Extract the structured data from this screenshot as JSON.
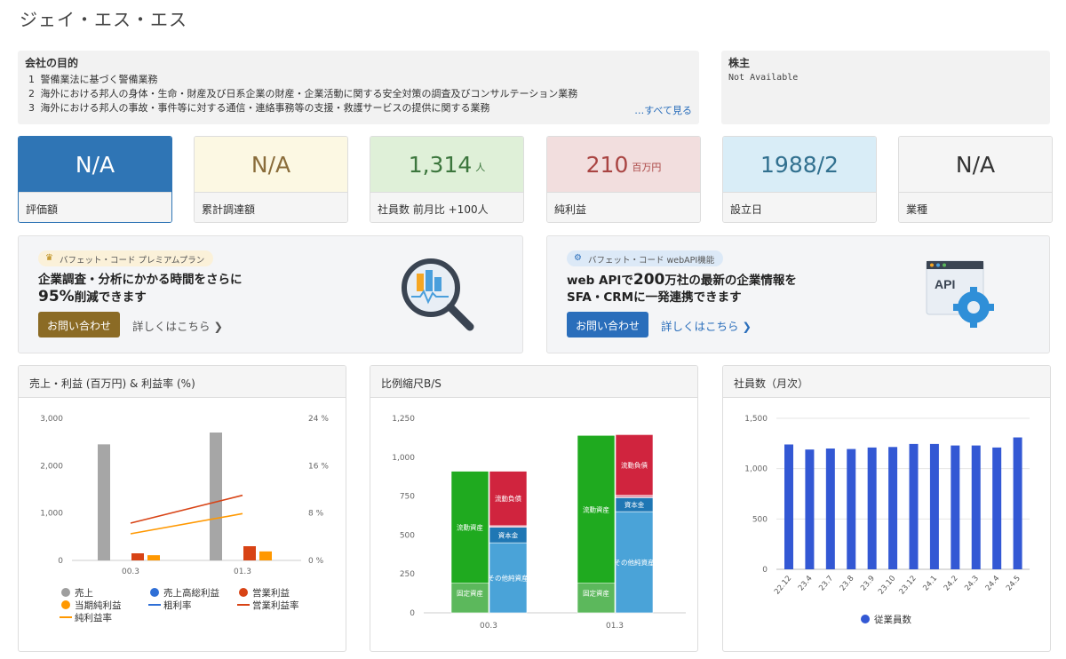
{
  "company": {
    "name": "ジェイ・エス・エス"
  },
  "purpose": {
    "heading": "会社の目的",
    "items": [
      {
        "no": "1",
        "text": "警備業法に基づく警備業務"
      },
      {
        "no": "2",
        "text": "海外における邦人の身体・生命・財産及び日系企業の財産・企業活動に関する安全対策の調査及びコンサルテーション業務"
      },
      {
        "no": "3",
        "text": "海外における邦人の事故・事件等に対する通信・連絡事務等の支援・救護サービスの提供に関する業務"
      }
    ],
    "see_all": "…すべて見る"
  },
  "shareholders": {
    "heading": "株主",
    "value": "Not Available"
  },
  "stats": [
    {
      "value": "N/A",
      "unit": "",
      "label": "評価額",
      "bg": "#2f75b5",
      "fg": "#ffffff"
    },
    {
      "value": "N/A",
      "unit": "",
      "label": "累計調達額",
      "bg": "#fcf8e3",
      "fg": "#8a6d3b"
    },
    {
      "value": "1,314",
      "unit": "人",
      "label": "社員数 前月比 +100人",
      "bg": "#dff0d8",
      "fg": "#3c763d"
    },
    {
      "value": "210",
      "unit": "百万円",
      "label": "純利益",
      "bg": "#f2dede",
      "fg": "#a94442"
    },
    {
      "value": "1988/2",
      "unit": "",
      "label": "設立日",
      "bg": "#d9edf7",
      "fg": "#31708f"
    },
    {
      "value": "N/A",
      "unit": "",
      "label": "業種",
      "bg": "#f5f5f5",
      "fg": "#333333"
    }
  ],
  "promo_left": {
    "pill": "バフェット・コード プレミアムプラン",
    "line1": "企業調査・分析にかかる時間をさらに",
    "line2_big": "95%",
    "line2_rest": "削減できます",
    "button": "お問い合わせ",
    "more": "詳しくはこちら",
    "button_color": "#8b6b25"
  },
  "promo_right": {
    "pill": "バフェット・コード webAPI機能",
    "line1_a": "web APIで",
    "line1_big": "200",
    "line1_b": "万社の最新の企業情報を",
    "line2": "SFA・CRMに一発連携できます",
    "button": "お問い合わせ",
    "more": "詳しくはこちら",
    "api_label": "API",
    "button_color": "#2a6ebb"
  },
  "panels": {
    "pl": "売上・利益 (百万円) & 利益率 (%)",
    "bs": "比例縮尺B/S",
    "emp": "社員数（月次）"
  },
  "legend_pl": [
    {
      "label": "売上",
      "color": "#9e9e9e",
      "kind": "dot"
    },
    {
      "label": "売上高総利益",
      "color": "#2f6fd6",
      "kind": "dot"
    },
    {
      "label": "営業利益",
      "color": "#d84315",
      "kind": "dot"
    },
    {
      "label": "当期純利益",
      "color": "#ff9800",
      "kind": "dot"
    },
    {
      "label": "粗利率",
      "color": "#2f6fd6",
      "kind": "line"
    },
    {
      "label": "営業利益率",
      "color": "#d84315",
      "kind": "line"
    },
    {
      "label": "純利益率",
      "color": "#ff9800",
      "kind": "line"
    }
  ],
  "legend_emp": {
    "label": "従業員数",
    "color": "#3358d4"
  },
  "chart_data": [
    {
      "type": "bar",
      "title": "売上・利益 (百万円) & 利益率 (%)",
      "categories": [
        "00.3",
        "01.3"
      ],
      "y_ticks": [
        "0",
        "1,000",
        "2,000",
        "3,000"
      ],
      "y2_ticks": [
        "0 %",
        "8 %",
        "16 %",
        "24 %"
      ],
      "ylim": [
        0,
        3000
      ],
      "y2lim": [
        0,
        24
      ],
      "series": [
        {
          "name": "売上",
          "kind": "bar",
          "color": "#a6a6a6",
          "values": [
            2450,
            2700
          ]
        },
        {
          "name": "営業利益",
          "kind": "bar",
          "color": "#d84315",
          "values": [
            150,
            300
          ]
        },
        {
          "name": "当期純利益",
          "kind": "bar",
          "color": "#ff9800",
          "values": [
            110,
            190
          ]
        },
        {
          "name": "営業利益率",
          "kind": "line",
          "axis": "y2",
          "color": "#d84315",
          "values": [
            6.3,
            11.0
          ]
        },
        {
          "name": "純利益率",
          "kind": "line",
          "axis": "y2",
          "color": "#ff9800",
          "values": [
            4.5,
            7.9
          ]
        }
      ]
    },
    {
      "type": "bar",
      "title": "比例縮尺B/S",
      "categories": [
        "00.3",
        "01.3"
      ],
      "y_ticks": [
        "0",
        "250",
        "500",
        "750",
        "1,000",
        "1,250"
      ],
      "ylim": [
        0,
        1250
      ],
      "assets": [
        [
          {
            "name": "固定資産",
            "value": 190,
            "color": "#5cb85c"
          },
          {
            "name": "流動資産",
            "value": 720,
            "color": "#1faa1f"
          }
        ],
        [
          {
            "name": "固定資産",
            "value": 190,
            "color": "#5cb85c"
          },
          {
            "name": "流動資産",
            "value": 950,
            "color": "#1faa1f"
          }
        ]
      ],
      "liabilities": [
        [
          {
            "name": "その他純資産",
            "value": 450,
            "color": "#4aa3d8"
          },
          {
            "name": "資本金",
            "value": 100,
            "color": "#1f77b4"
          },
          {
            "name": "",
            "value": 10,
            "color": "#e8a3b5"
          },
          {
            "name": "流動負債",
            "value": 350,
            "color": "#d0243e"
          }
        ],
        [
          {
            "name": "その他純資産",
            "value": 650,
            "color": "#4aa3d8"
          },
          {
            "name": "資本金",
            "value": 90,
            "color": "#1f77b4"
          },
          {
            "name": "",
            "value": 15,
            "color": "#e8a3b5"
          },
          {
            "name": "流動負債",
            "value": 390,
            "color": "#d0243e"
          }
        ]
      ]
    },
    {
      "type": "bar",
      "title": "社員数（月次）",
      "categories": [
        "22.12",
        "23.4",
        "23.7",
        "23.8",
        "23.9",
        "23.10",
        "23.12",
        "24.1",
        "24.2",
        "24.3",
        "24.4",
        "24.5"
      ],
      "y_ticks": [
        "0",
        "500",
        "1,000",
        "1,500"
      ],
      "ylim": [
        0,
        1500
      ],
      "series": [
        {
          "name": "従業員数",
          "color": "#3358d4",
          "values": [
            1240,
            1190,
            1200,
            1195,
            1210,
            1215,
            1245,
            1245,
            1230,
            1230,
            1210,
            1310
          ]
        }
      ]
    }
  ]
}
